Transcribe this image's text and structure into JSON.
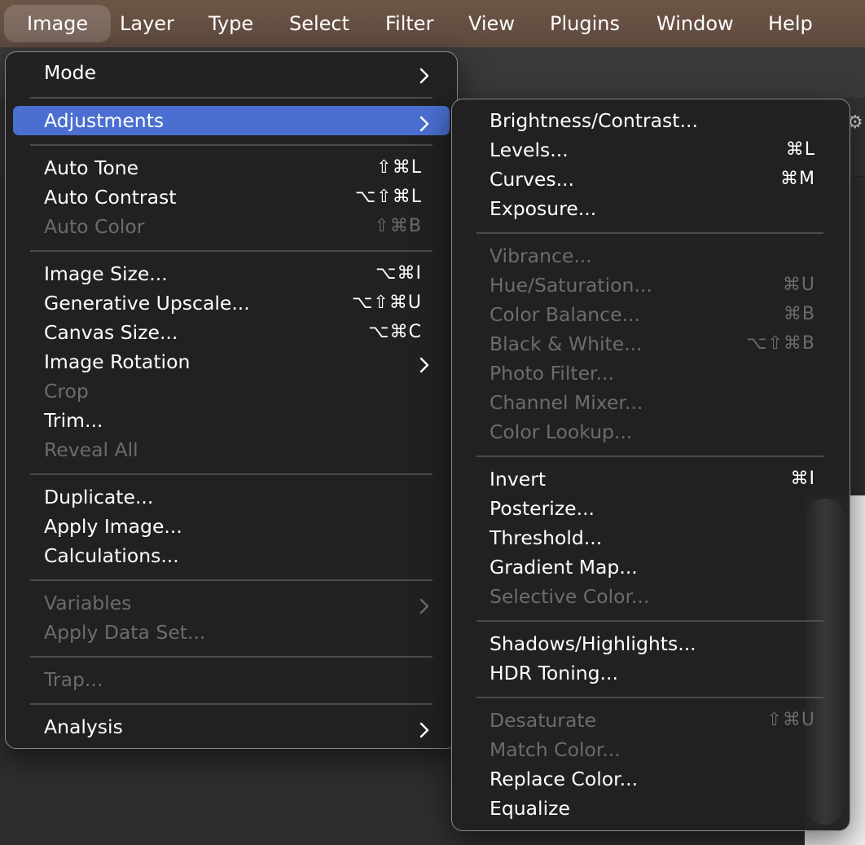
{
  "menubar": {
    "items": [
      "Image",
      "Layer",
      "Type",
      "Select",
      "Filter",
      "View",
      "Plugins",
      "Window",
      "Help"
    ],
    "active_index": 0
  },
  "image_menu": {
    "items": [
      {
        "label": "Mode",
        "shortcut": "",
        "submenu": true,
        "disabled": false
      },
      {
        "label": "Adjustments",
        "shortcut": "",
        "submenu": true,
        "disabled": false,
        "highlighted": true
      },
      {
        "label": "Auto Tone",
        "shortcut": "⇧⌘L",
        "submenu": false,
        "disabled": false
      },
      {
        "label": "Auto Contrast",
        "shortcut": "⌥⇧⌘L",
        "submenu": false,
        "disabled": false
      },
      {
        "label": "Auto Color",
        "shortcut": "⇧⌘B",
        "submenu": false,
        "disabled": true
      },
      {
        "label": "Image Size...",
        "shortcut": "⌥⌘I",
        "submenu": false,
        "disabled": false
      },
      {
        "label": "Generative Upscale...",
        "shortcut": "⌥⇧⌘U",
        "submenu": false,
        "disabled": false
      },
      {
        "label": "Canvas Size...",
        "shortcut": "⌥⌘C",
        "submenu": false,
        "disabled": false
      },
      {
        "label": "Image Rotation",
        "shortcut": "",
        "submenu": true,
        "disabled": false
      },
      {
        "label": "Crop",
        "shortcut": "",
        "submenu": false,
        "disabled": true
      },
      {
        "label": "Trim...",
        "shortcut": "",
        "submenu": false,
        "disabled": false
      },
      {
        "label": "Reveal All",
        "shortcut": "",
        "submenu": false,
        "disabled": true
      },
      {
        "label": "Duplicate...",
        "shortcut": "",
        "submenu": false,
        "disabled": false
      },
      {
        "label": "Apply Image...",
        "shortcut": "",
        "submenu": false,
        "disabled": false
      },
      {
        "label": "Calculations...",
        "shortcut": "",
        "submenu": false,
        "disabled": false
      },
      {
        "label": "Variables",
        "shortcut": "",
        "submenu": true,
        "disabled": true
      },
      {
        "label": "Apply Data Set...",
        "shortcut": "",
        "submenu": false,
        "disabled": true
      },
      {
        "label": "Trap...",
        "shortcut": "",
        "submenu": false,
        "disabled": true
      },
      {
        "label": "Analysis",
        "shortcut": "",
        "submenu": true,
        "disabled": false
      }
    ]
  },
  "adjustments_menu": {
    "items": [
      {
        "label": "Brightness/Contrast...",
        "shortcut": "",
        "disabled": false
      },
      {
        "label": "Levels...",
        "shortcut": "⌘L",
        "disabled": false
      },
      {
        "label": "Curves...",
        "shortcut": "⌘M",
        "disabled": false
      },
      {
        "label": "Exposure...",
        "shortcut": "",
        "disabled": false
      },
      {
        "label": "Vibrance...",
        "shortcut": "",
        "disabled": true
      },
      {
        "label": "Hue/Saturation...",
        "shortcut": "⌘U",
        "disabled": true
      },
      {
        "label": "Color Balance...",
        "shortcut": "⌘B",
        "disabled": true
      },
      {
        "label": "Black & White...",
        "shortcut": "⌥⇧⌘B",
        "disabled": true
      },
      {
        "label": "Photo Filter...",
        "shortcut": "",
        "disabled": true
      },
      {
        "label": "Channel Mixer...",
        "shortcut": "",
        "disabled": true
      },
      {
        "label": "Color Lookup...",
        "shortcut": "",
        "disabled": true
      },
      {
        "label": "Invert",
        "shortcut": "⌘I",
        "disabled": false
      },
      {
        "label": "Posterize...",
        "shortcut": "",
        "disabled": false
      },
      {
        "label": "Threshold...",
        "shortcut": "",
        "disabled": false
      },
      {
        "label": "Gradient Map...",
        "shortcut": "",
        "disabled": false
      },
      {
        "label": "Selective Color...",
        "shortcut": "",
        "disabled": true
      },
      {
        "label": "Shadows/Highlights...",
        "shortcut": "",
        "disabled": false
      },
      {
        "label": "HDR Toning...",
        "shortcut": "",
        "disabled": false
      },
      {
        "label": "Desaturate",
        "shortcut": "⇧⌘U",
        "disabled": true
      },
      {
        "label": "Match Color...",
        "shortcut": "",
        "disabled": true
      },
      {
        "label": "Replace Color...",
        "shortcut": "",
        "disabled": false
      },
      {
        "label": "Equalize",
        "shortcut": "",
        "disabled": false
      }
    ]
  },
  "colors": {
    "highlight": "#4a6fd0",
    "disabled_text": "#6c6c6c",
    "menubar": "#6d5546"
  }
}
